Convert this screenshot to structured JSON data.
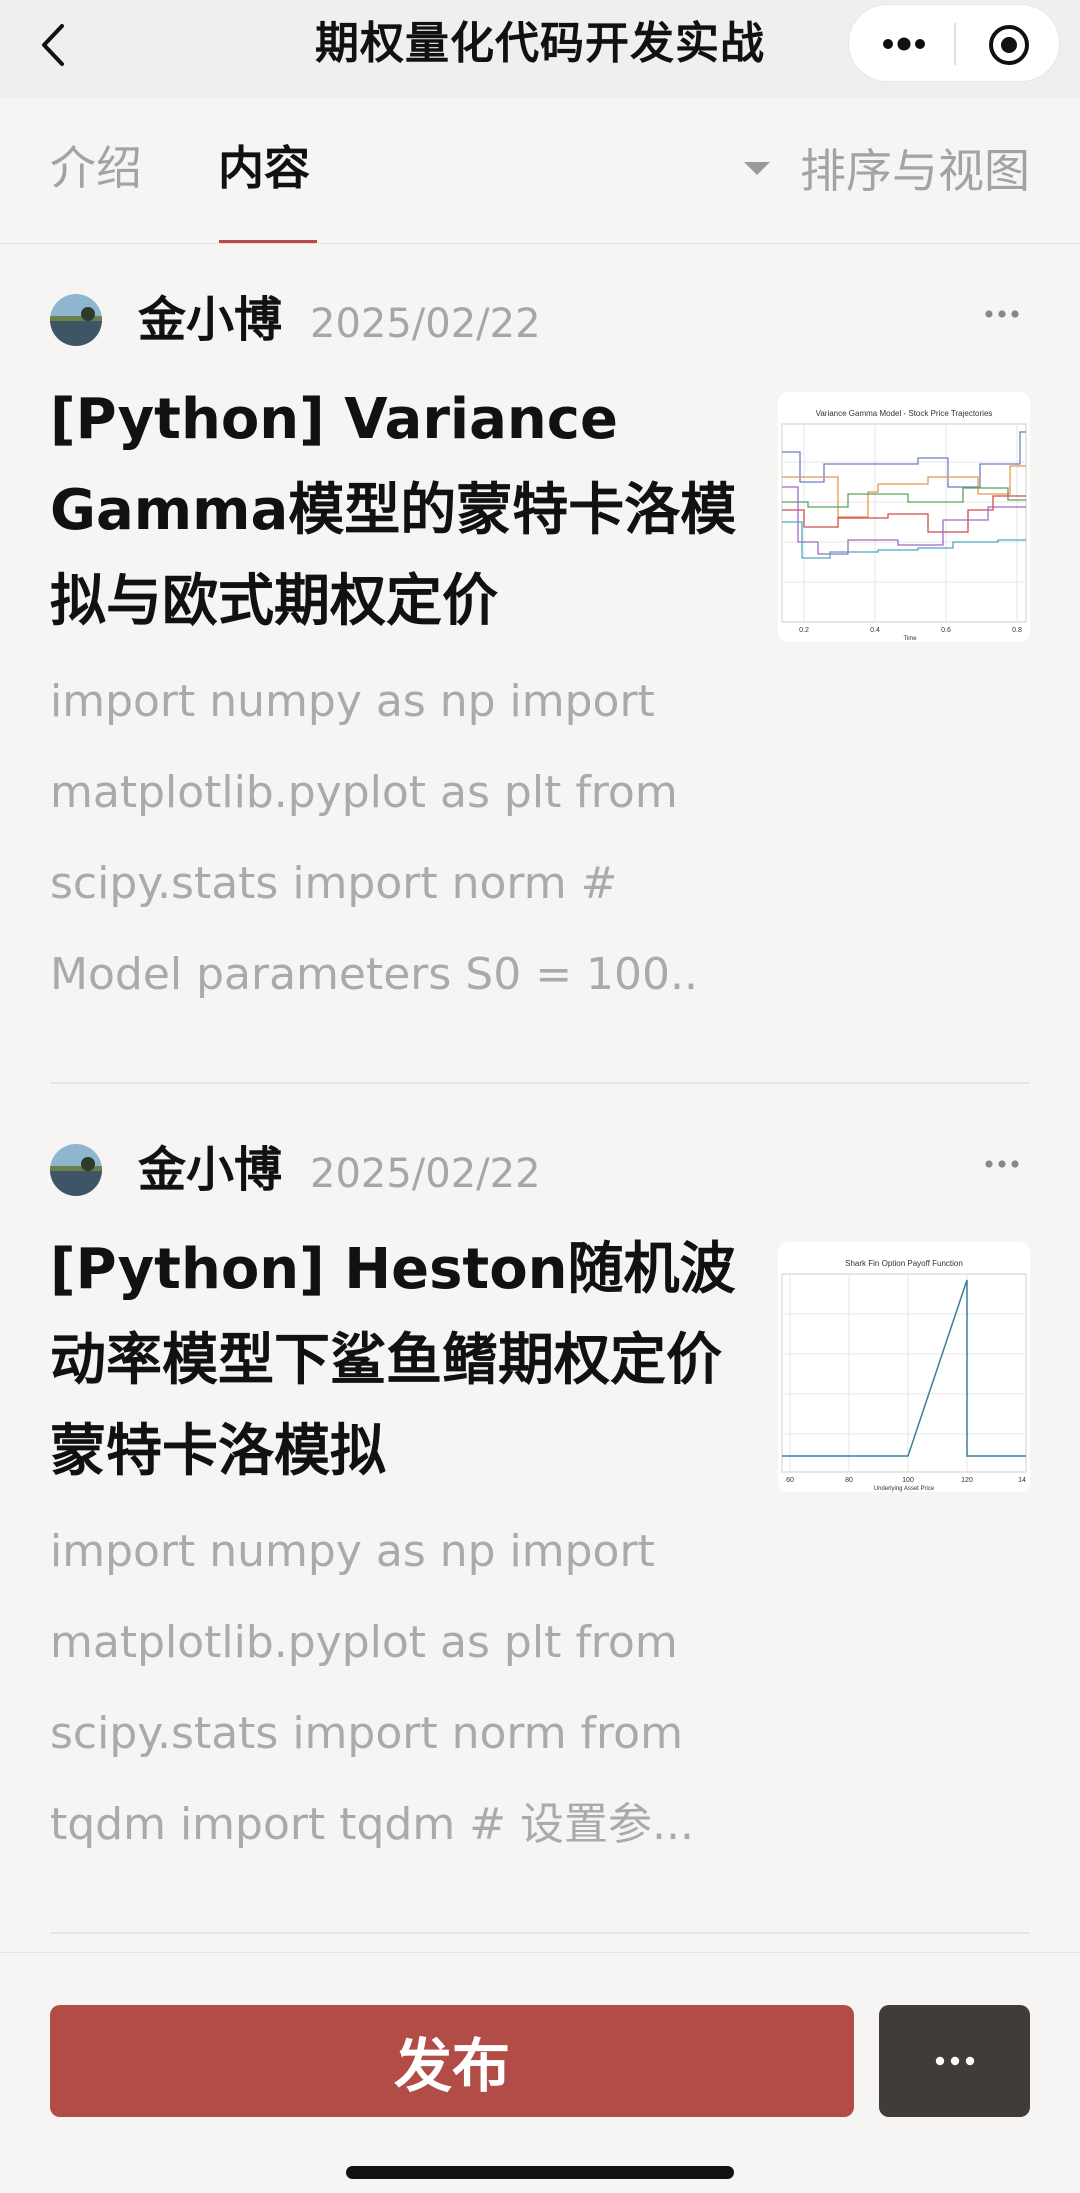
{
  "topbar": {
    "title": "期权量化代码开发实战"
  },
  "tabs": {
    "intro": "介绍",
    "content": "内容",
    "sort_view": "排序与视图"
  },
  "articles": [
    {
      "author": "金小博",
      "date": "2025/02/22",
      "title": "[Python] Variance Gamma模型的蒙特卡洛模拟与欧式期权定价",
      "excerpt": "import numpy as np import matplotlib.pyplot as plt from scipy.stats import norm # Model parameters S0 = 100..",
      "thumb_title": "Variance Gamma Model - Stock Price Trajectories",
      "thumb_ticks": [
        "0.2",
        "0.4",
        "0.6",
        "0.8"
      ],
      "thumb_xlabel": "Time"
    },
    {
      "author": "金小博",
      "date": "2025/02/22",
      "title": "[Python] Heston随机波动率模型下鲨鱼鳍期权定价蒙特卡洛模拟",
      "excerpt": "import numpy as np import matplotlib.pyplot as plt from scipy.stats import norm from tqdm import tqdm # 设置参...",
      "thumb_title": "Shark Fin Option Payoff Function",
      "thumb_ticks": [
        "60",
        "80",
        "100",
        "120",
        "14"
      ],
      "thumb_xlabel": "Underlying Asset Price"
    }
  ],
  "bottom": {
    "publish_label": "发布"
  },
  "colors": {
    "accent": "#b24c47",
    "dark_button": "#3f3c3a"
  }
}
